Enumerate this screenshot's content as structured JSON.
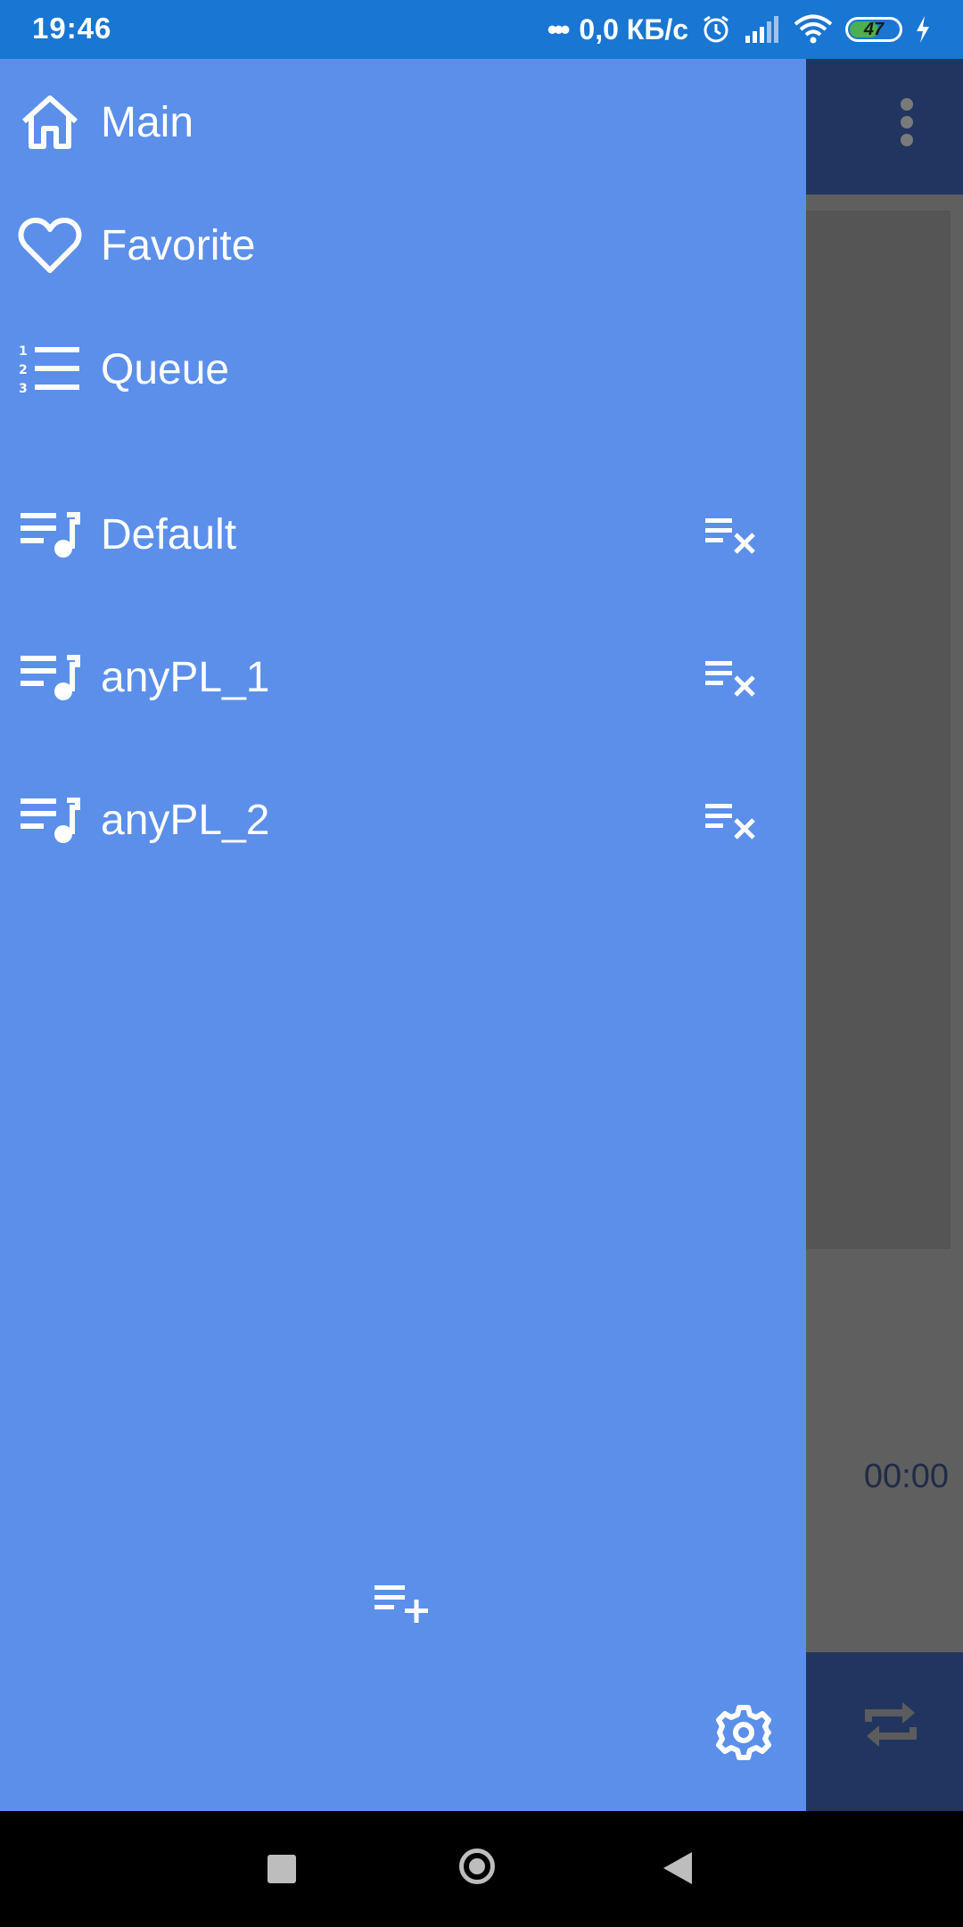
{
  "status_bar": {
    "time": "19:46",
    "dots": "•••",
    "speed": "0,0 КБ/с",
    "battery": "47",
    "icons": [
      "alarm-icon",
      "signal-icon",
      "wifi-icon",
      "battery-icon",
      "charging-icon"
    ]
  },
  "drawer": {
    "nav": [
      {
        "label": "Main",
        "icon": "home-icon"
      },
      {
        "label": "Favorite",
        "icon": "heart-icon"
      },
      {
        "label": "Queue",
        "icon": "numbered-list-icon"
      }
    ],
    "playlists": [
      {
        "label": "Default",
        "icon": "playlist-music-icon",
        "action_icon": "playlist-remove-icon"
      },
      {
        "label": "anyPL_1",
        "icon": "playlist-music-icon",
        "action_icon": "playlist-remove-icon"
      },
      {
        "label": "anyPL_2",
        "icon": "playlist-music-icon",
        "action_icon": "playlist-remove-icon"
      }
    ],
    "add_playlist_icon": "playlist-add-icon",
    "settings_icon": "gear-icon"
  },
  "background_app": {
    "elapsed_time": "00:00",
    "menu_icon": "more-vertical-icon",
    "repeat_icon": "repeat-icon"
  },
  "colors": {
    "status_bar": "#1976d2",
    "drawer": "#5b8fea",
    "app_header": "#223560"
  }
}
